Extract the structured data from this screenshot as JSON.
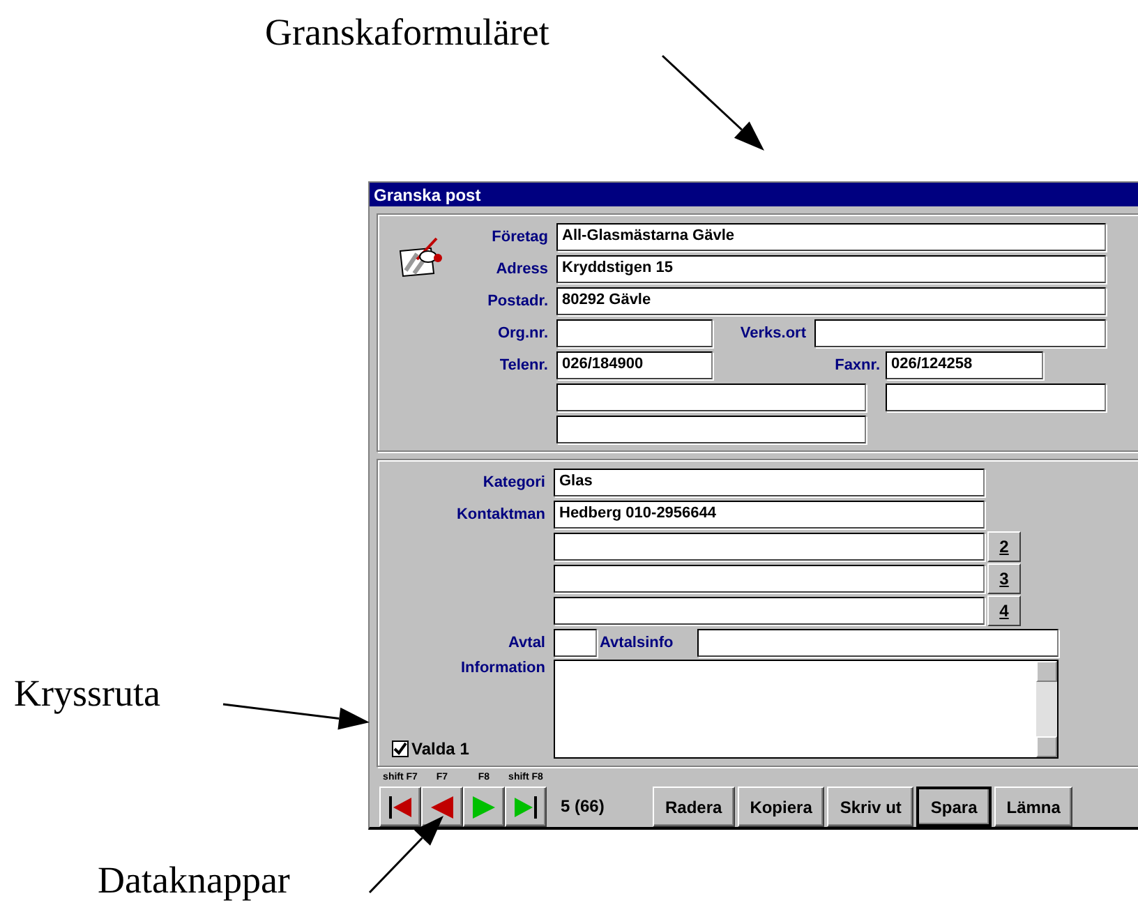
{
  "annotations": [
    {
      "text": "Granskaformuläret"
    },
    {
      "text": "Kryssruta"
    },
    {
      "text": "Dataknappar"
    }
  ],
  "window": {
    "title": "Granska post"
  },
  "company": {
    "fields": [
      {
        "label": "Företag",
        "value": "All-Glasmästarna Gävle"
      },
      {
        "label": "Adress",
        "value": "Kryddstigen 15"
      },
      {
        "label": "Postadr.",
        "value": "80292 Gävle"
      }
    ],
    "org_nr": {
      "label": "Org.nr."
    },
    "verks_ort": {
      "label": "Verks.ort"
    },
    "phone": {
      "label": "Telenr.",
      "value": "026/184900"
    },
    "fax": {
      "label": "Faxnr.",
      "value": "026/124258"
    }
  },
  "contact": {
    "category": {
      "label": "Kategori",
      "value": "Glas"
    },
    "contact_person": {
      "label": "Kontaktman",
      "value": "Hedberg 010-2956644"
    },
    "extra_buttons": [
      "2",
      "3",
      "4"
    ],
    "agreement": {
      "label": "Avtal"
    },
    "agreement_info": {
      "label": "Avtalsinfo"
    },
    "information": {
      "label": "Information"
    },
    "selected": {
      "label": "Valda 1",
      "checked": true
    }
  },
  "navigation": {
    "buttons": [
      {
        "key": "shift F7",
        "kind": "first"
      },
      {
        "key": "F7",
        "kind": "prev"
      },
      {
        "key": "F8",
        "kind": "next"
      },
      {
        "key": "shift F8",
        "kind": "last"
      }
    ],
    "record": "5 (66)"
  },
  "actions": [
    {
      "label": "Radera",
      "default": false
    },
    {
      "label": "Kopiera",
      "default": false
    },
    {
      "label": "Skriv ut",
      "default": false
    },
    {
      "label": "Spara",
      "default": true
    },
    {
      "label": "Lämna",
      "default": false
    }
  ]
}
